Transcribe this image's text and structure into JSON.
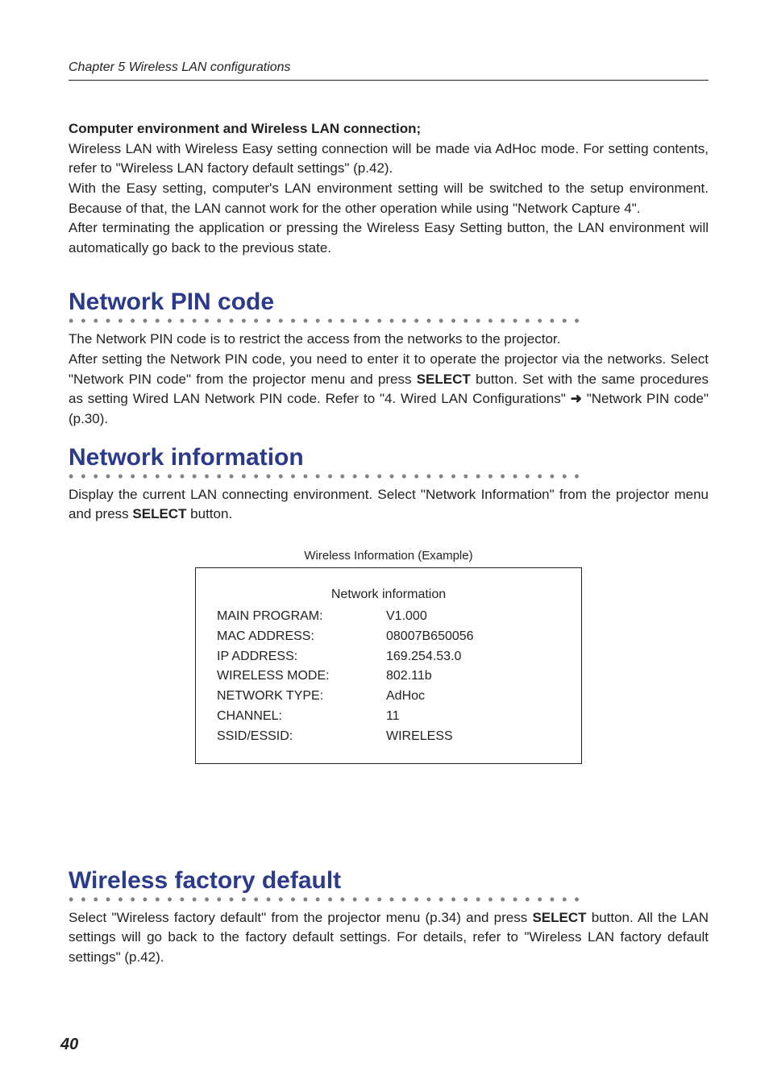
{
  "header": {
    "chapter": "Chapter 5 Wireless LAN configurations"
  },
  "intro": {
    "heading": "Computer environment and Wireless LAN connection;",
    "p1": "Wireless LAN with Wireless Easy setting connection will be made via AdHoc mode.  For setting contents, refer to \"Wireless LAN factory default settings\" (p.42).",
    "p2": "With the Easy setting, computer's LAN environment setting will be switched to the setup environment. Because of that, the LAN cannot work for the other operation while using \"Network Capture 4\".",
    "p3": "After terminating the application or pressing the Wireless Easy Setting button, the LAN environment will automatically go back to the previous state."
  },
  "sections": {
    "pin": {
      "title": "Network PIN code",
      "p1": "The Network PIN code is to restrict the access from the networks to the projector.",
      "p2a": "After setting the Network PIN code, you need to enter it to operate the projector via the networks. Select \"Network PIN code\" from the projector menu and press ",
      "p2b": "SELECT",
      "p2c": " button. Set with the same procedures as setting Wired LAN Network PIN code. Refer to \"4. Wired LAN Configurations\" ",
      "arrow": "➜",
      "p2d": " \"Network PIN code\" (p.30)."
    },
    "info": {
      "title": "Network information",
      "p1a": "Display the current LAN connecting environment. Select \"Network Information\" from the projector menu and press ",
      "p1b": "SELECT",
      "p1c": " button.",
      "example_label": "Wireless Information (Example)",
      "box_title": "Network information",
      "rows": [
        {
          "label": "MAIN PROGRAM:",
          "value": "V1.000"
        },
        {
          "label": "MAC ADDRESS:",
          "value": "08007B650056"
        },
        {
          "label": "IP ADDRESS:",
          "value": "169.254.53.0"
        },
        {
          "label": "WIRELESS MODE:",
          "value": "802.11b"
        },
        {
          "label": "NETWORK TYPE:",
          "value": "AdHoc"
        },
        {
          "label": "CHANNEL:",
          "value": "11"
        },
        {
          "label": "SSID/ESSID:",
          "value": "WIRELESS"
        }
      ]
    },
    "factory": {
      "title": "Wireless factory default",
      "p1a": "Select \"Wireless factory default\" from the projector menu (p.34) and press ",
      "p1b": "SELECT",
      "p1c": " button.  All the LAN settings will go back to the factory default settings. For details, refer to \"Wireless LAN factory default settings\" (p.42)."
    }
  },
  "page_number": "40",
  "dots": "••••••••••••••••••••••••••••••••••••••••••"
}
